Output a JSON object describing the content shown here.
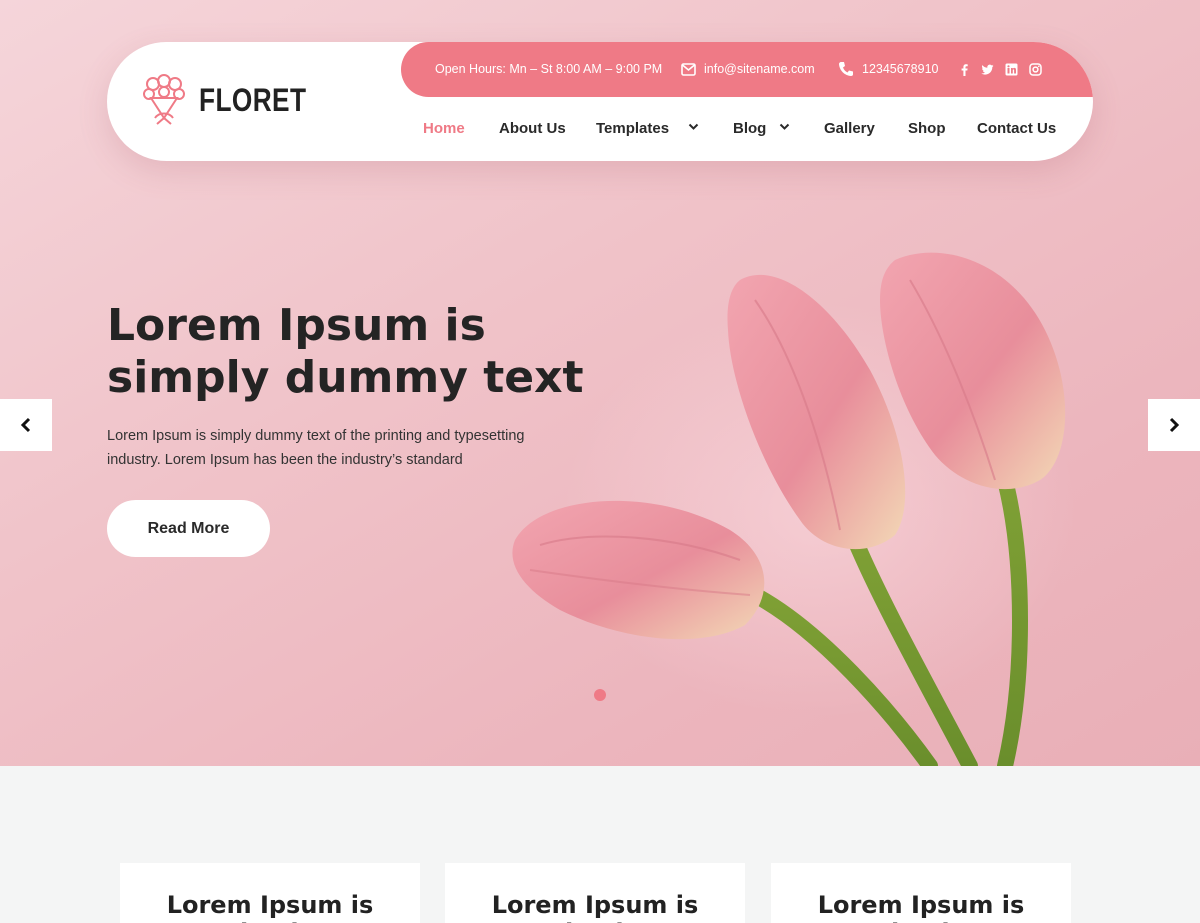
{
  "brand": {
    "name": "FLORET"
  },
  "topbar": {
    "hours": "Open Hours: Mn – St 8:00 AM – 9:00 PM",
    "email": "info@sitename.com",
    "phone": "12345678910",
    "social": [
      "facebook-icon",
      "twitter-icon",
      "linkedin-icon",
      "instagram-icon"
    ]
  },
  "nav": {
    "items": [
      {
        "label": "Home",
        "active": true
      },
      {
        "label": "About Us"
      },
      {
        "label": "Templates",
        "dropdown": true
      },
      {
        "label": "Blog",
        "dropdown": true
      },
      {
        "label": "Gallery"
      },
      {
        "label": "Shop"
      },
      {
        "label": "Contact Us"
      }
    ]
  },
  "hero": {
    "title": "Lorem Ipsum is simply dummy text",
    "description": "Lorem Ipsum is simply dummy text of the printing and typesetting industry. Lorem Ipsum has been the industry’s standard",
    "button": "Read More",
    "slide_count": 1,
    "active_slide": 1
  },
  "cards": [
    {
      "title": "Lorem Ipsum is simply"
    },
    {
      "title": "Lorem Ipsum is simply"
    },
    {
      "title": "Lorem Ipsum is simply"
    }
  ],
  "colors": {
    "accent": "#ef7a86",
    "hero_bg": "#f0c3c9",
    "text": "#242424"
  }
}
